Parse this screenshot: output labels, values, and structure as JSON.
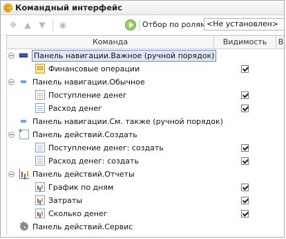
{
  "window": {
    "title": "Командный интерфейс"
  },
  "toolbar": {
    "filter_label": "Отбор по ролям:",
    "filter_value": "<Не установлен>"
  },
  "grid": {
    "columns": [
      "Команда",
      "Видимость",
      "В"
    ],
    "rows": [
      {
        "type": "group",
        "icon": "nav-panel-icon",
        "label": "Панель навигации.Важное (ручной порядок)",
        "selected": true,
        "toggle": true
      },
      {
        "type": "item",
        "icon": "finance-icon",
        "label": "Финансовые операции",
        "visible": true
      },
      {
        "type": "group",
        "icon": "nav-panel-light-icon",
        "label": "Панель навигации.Обычное",
        "toggle": true
      },
      {
        "type": "item",
        "icon": "document-icon",
        "label": "Поступление денег",
        "visible": true
      },
      {
        "type": "item",
        "icon": "document-icon",
        "label": "Расход денег",
        "visible": true
      },
      {
        "type": "group",
        "icon": "nav-panel-light-icon",
        "label": "Панель навигации.См. также (ручной порядок)",
        "toggle": false
      },
      {
        "type": "group",
        "icon": "create-action-icon",
        "label": "Панель действий.Создать",
        "toggle": true
      },
      {
        "type": "item",
        "icon": "document-icon",
        "label": "Поступление денег: создать",
        "visible": true
      },
      {
        "type": "item",
        "icon": "document-icon",
        "label": "Расход денег: создать",
        "visible": true
      },
      {
        "type": "group",
        "icon": "reports-icon",
        "label": "Панель действий.Отчеты",
        "toggle": true
      },
      {
        "type": "item",
        "icon": "chart-icon",
        "label": "График по дням",
        "visible": true
      },
      {
        "type": "item",
        "icon": "chart-icon",
        "label": "Затраты",
        "visible": true
      },
      {
        "type": "item",
        "icon": "chart-icon",
        "label": "Сколько денег",
        "visible": true
      },
      {
        "type": "group",
        "icon": "gear-icon",
        "label": "Панель действий.Сервис",
        "toggle": false
      }
    ]
  }
}
